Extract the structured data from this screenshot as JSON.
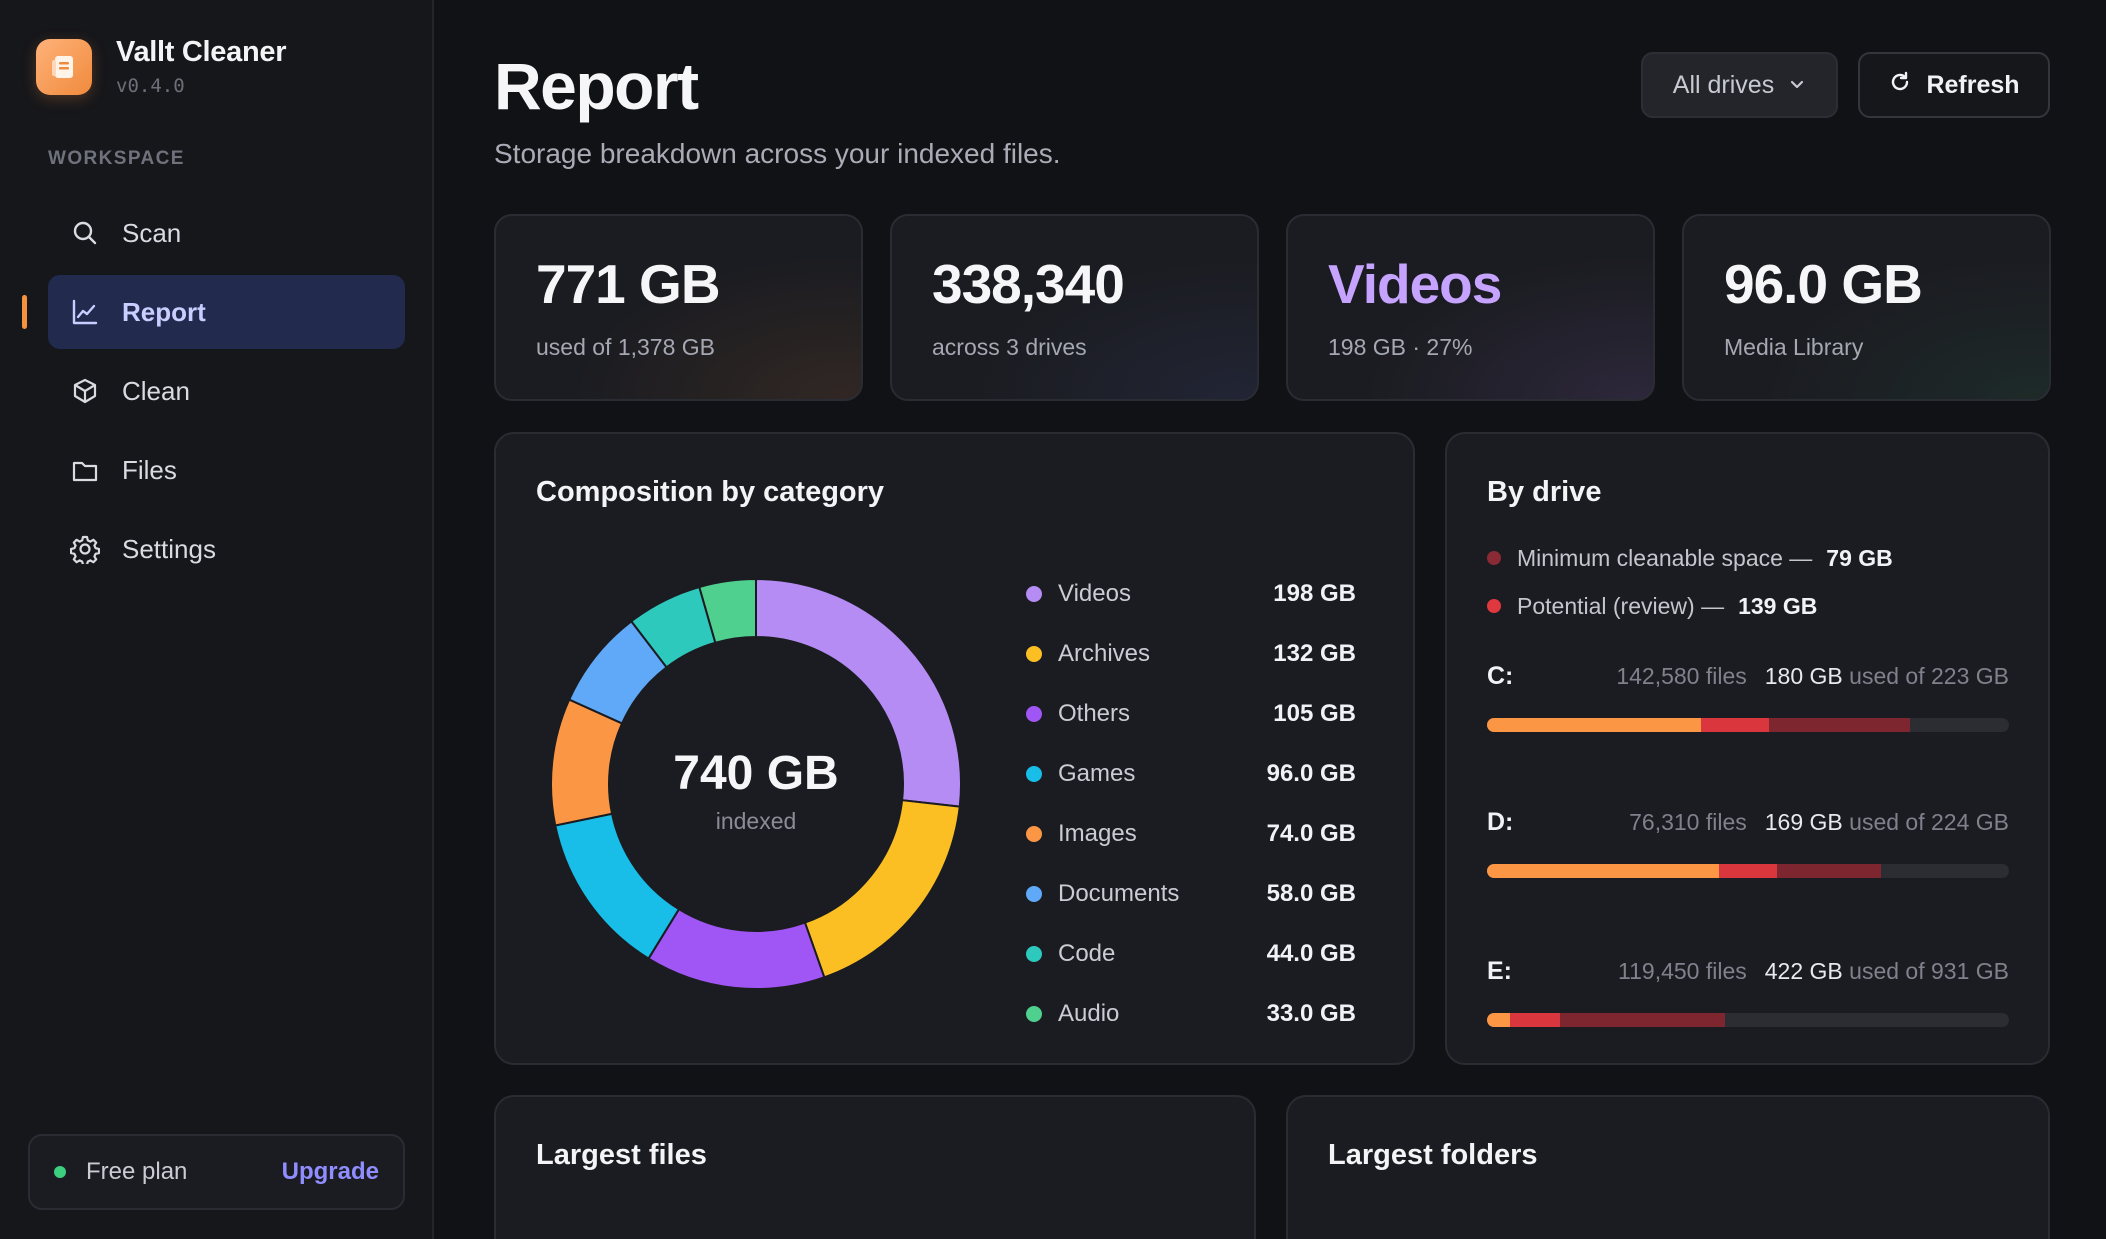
{
  "app": {
    "name": "Vallt Cleaner",
    "version": "v0.4.0"
  },
  "sidebar": {
    "section_label": "WORKSPACE",
    "items": [
      {
        "label": "Scan",
        "icon": "search-icon"
      },
      {
        "label": "Report",
        "icon": "chart-line-icon",
        "active": true
      },
      {
        "label": "Clean",
        "icon": "cube-icon"
      },
      {
        "label": "Files",
        "icon": "folder-icon"
      },
      {
        "label": "Settings",
        "icon": "gear-icon"
      }
    ],
    "plan": {
      "label": "Free plan",
      "action": "Upgrade"
    }
  },
  "header": {
    "title": "Report",
    "subtitle": "Storage breakdown across your indexed files.",
    "drive_select": "All drives",
    "refresh_label": "Refresh"
  },
  "stats": [
    {
      "value": "771 GB",
      "sub": "used of 1,378 GB"
    },
    {
      "value": "338,340",
      "sub": "across 3 drives"
    },
    {
      "value": "Videos",
      "sub": "198 GB · 27%",
      "accent": "#c5a3ff"
    },
    {
      "value": "96.0 GB",
      "sub": "Media Library"
    }
  ],
  "composition": {
    "title": "Composition by category",
    "center_value": "740 GB",
    "center_label": "indexed"
  },
  "chart_data": {
    "type": "pie",
    "categories": [
      "Videos",
      "Archives",
      "Others",
      "Games",
      "Images",
      "Documents",
      "Code",
      "Audio"
    ],
    "values": [
      198,
      132,
      105,
      96.0,
      74.0,
      58.0,
      44.0,
      33.0
    ],
    "labels": [
      "198 GB",
      "132 GB",
      "105 GB",
      "96.0 GB",
      "74.0 GB",
      "58.0 GB",
      "44.0 GB",
      "33.0 GB"
    ],
    "colors": [
      "#b58cf3",
      "#fbbf24",
      "#a055f5",
      "#18bde8",
      "#fb9645",
      "#5fa9f8",
      "#2ec9bd",
      "#4fd08f"
    ],
    "legend_position": "right"
  },
  "by_drive": {
    "title": "By drive",
    "legend": [
      {
        "label": "Minimum cleanable space —",
        "value": "79 GB",
        "color": "#8a2a34"
      },
      {
        "label": "Potential (review) —",
        "value": "139 GB",
        "color": "#e0383f"
      }
    ],
    "drives": [
      {
        "letter": "C:",
        "files": "142,580 files",
        "used": "180 GB",
        "total": "used of 223 GB",
        "segments": [
          0.41,
          0.13,
          0.27
        ]
      },
      {
        "letter": "D:",
        "files": "76,310 files",
        "used": "169 GB",
        "total": "used of 224 GB",
        "segments": [
          0.445,
          0.11,
          0.2
        ]
      },
      {
        "letter": "E:",
        "files": "119,450 files",
        "used": "422 GB",
        "total": "used of 931 GB",
        "segments": [
          0.045,
          0.095,
          0.315
        ]
      }
    ],
    "segment_colors": [
      "#fb9645",
      "#d9363e",
      "#7d2630"
    ]
  },
  "bottom": {
    "largest_files": "Largest files",
    "largest_folders": "Largest folders"
  },
  "colors": {
    "accent": "#8f8dff",
    "active_bg": "#222a4e",
    "indicator": "#f5923e"
  }
}
